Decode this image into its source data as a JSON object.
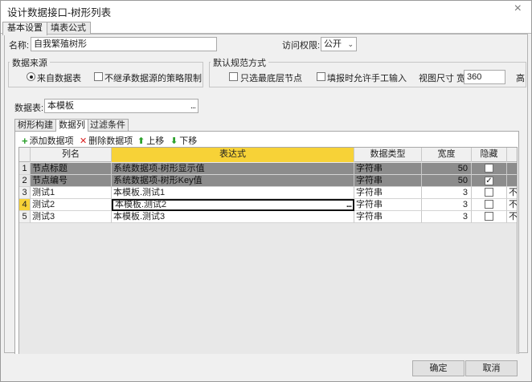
{
  "window": {
    "title": "设计数据接口-树形列表",
    "close_glyph": "×"
  },
  "main_tabs": [
    "基本设置",
    "填表公式"
  ],
  "name_field": {
    "label": "名称:",
    "value": "自我繁殖树形"
  },
  "access": {
    "label": "访问权限:",
    "value": "公开"
  },
  "data_source": {
    "title": "数据来源",
    "radio_label": "来自数据表",
    "checkbox_label": "不继承数据源的策略限制"
  },
  "defaults": {
    "title": "默认规范方式",
    "leaf_only_label": "只选最底层节点",
    "manual_input_label": "填报时允许手工输入",
    "view_size_label": "视图尺寸 宽",
    "width_value": "360",
    "height_label": "高"
  },
  "datasheet": {
    "label": "数据表:",
    "value": "本模板",
    "ellipsis": "..."
  },
  "sub_tabs": [
    "树形构建",
    "数据列",
    "过滤条件"
  ],
  "toolbar": {
    "add_label": "添加数据项",
    "add_icon": "+",
    "delete_label": "删除数据项",
    "delete_icon": "✕",
    "up_label": "上移",
    "up_icon": "⬆",
    "down_label": "下移",
    "down_icon": "⬇"
  },
  "grid": {
    "headers": [
      "列名",
      "表达式",
      "数据类型",
      "宽度",
      "隐藏"
    ],
    "rows": [
      {
        "n": "1",
        "name": "节点标题",
        "expr": "系统数据项-树形显示值",
        "type": "字符串",
        "width": "50",
        "hidden": "",
        "extra": ""
      },
      {
        "n": "2",
        "name": "节点编号",
        "expr": "系统数据项-树形Key值",
        "type": "字符串",
        "width": "50",
        "hidden": "✓",
        "extra": ""
      },
      {
        "n": "3",
        "name": "测试1",
        "expr": "本模板.测试1",
        "type": "字符串",
        "width": "3",
        "hidden": "",
        "extra": "不"
      },
      {
        "n": "4",
        "name": "测试2",
        "expr": "本模板.测试2",
        "type": "字符串",
        "width": "3",
        "hidden": "",
        "extra": "不"
      },
      {
        "n": "5",
        "name": "测试3",
        "expr": "本模板.测试3",
        "type": "字符串",
        "width": "3",
        "hidden": "",
        "extra": "不"
      }
    ],
    "edit_ellipsis": "..."
  },
  "footer": {
    "ok": "确定",
    "cancel": "取消"
  },
  "colors": {
    "accent": "#f7d237",
    "gray_row": "#8c8c8c",
    "add_icon": "#2ca02c",
    "delete_icon": "#d92020"
  }
}
